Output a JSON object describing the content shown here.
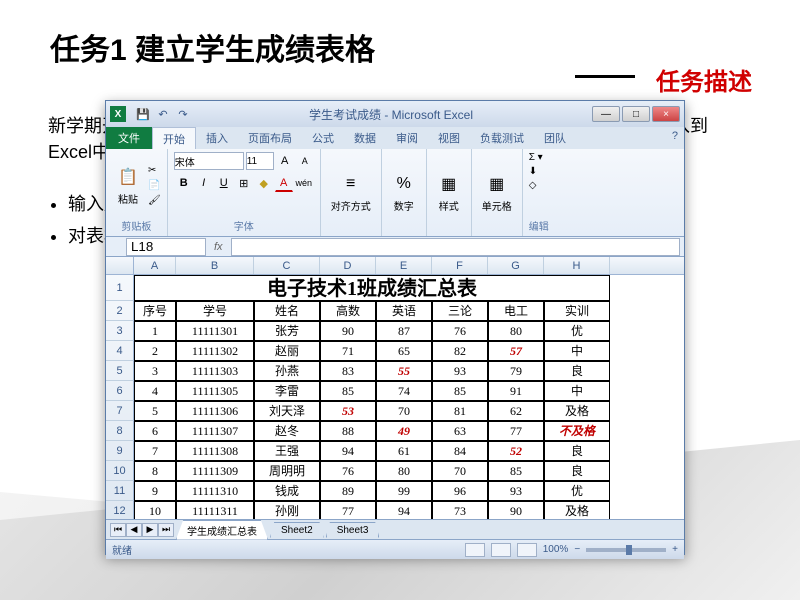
{
  "slide": {
    "title": "任务1  建立学生成绩表格",
    "subtitle": "任务描述",
    "desc1": "新学期开",
    "desc1_right": "勺成绩输入到",
    "desc2": "Excel中",
    "desc2_right": "：",
    "bullet1": "输入序",
    "bullet2": "对表格"
  },
  "window": {
    "app_icon": "X",
    "title": "学生考试成绩 - Microsoft Excel",
    "min": "—",
    "max": "□",
    "close": "×"
  },
  "tabs": {
    "file": "文件",
    "items": [
      "开始",
      "插入",
      "页面布局",
      "公式",
      "数据",
      "审阅",
      "视图",
      "负载测试",
      "团队"
    ],
    "help": "?"
  },
  "ribbon": {
    "clipboard": {
      "label": "剪贴板",
      "paste": "粘贴",
      "paste_icon": "📋"
    },
    "font": {
      "label": "字体",
      "name": "宋体",
      "size": "11",
      "bold": "B",
      "italic": "I",
      "underline": "U",
      "border": "⊞",
      "fill": "◆",
      "color": "A",
      "grow": "A",
      "shrink": "A",
      "wen": "wén"
    },
    "align": {
      "label": "对齐方式",
      "icon": "≡"
    },
    "number": {
      "label": "数字",
      "icon": "%"
    },
    "styles": {
      "label": "样式",
      "icon": "▦"
    },
    "cells": {
      "label": "单元格",
      "icon": "▦"
    },
    "editing": {
      "label": "编辑",
      "sigma": "Σ",
      "fill": "⬇",
      "clear": "◇"
    }
  },
  "namebox": {
    "cell": "L18",
    "fx": "fx"
  },
  "columns": [
    "A",
    "B",
    "C",
    "D",
    "E",
    "F",
    "G",
    "H"
  ],
  "table": {
    "title": "电子技术1班成绩汇总表",
    "headers": [
      "序号",
      "学号",
      "姓名",
      "高数",
      "英语",
      "三论",
      "电工",
      "实训"
    ],
    "rows": [
      {
        "n": "1",
        "id": "11111301",
        "name": "张芳",
        "c1": "90",
        "c2": "87",
        "c3": "76",
        "c4": "80",
        "c5": "优",
        "r2": false,
        "r4": false,
        "r5": false
      },
      {
        "n": "2",
        "id": "11111302",
        "name": "赵丽",
        "c1": "71",
        "c2": "65",
        "c3": "82",
        "c4": "57",
        "c5": "中",
        "r2": false,
        "r4": true,
        "r5": false
      },
      {
        "n": "3",
        "id": "11111303",
        "name": "孙燕",
        "c1": "83",
        "c2": "55",
        "c3": "93",
        "c4": "79",
        "c5": "良",
        "r2": true,
        "r4": false,
        "r5": false
      },
      {
        "n": "4",
        "id": "11111305",
        "name": "李雷",
        "c1": "85",
        "c2": "74",
        "c3": "85",
        "c4": "91",
        "c5": "中",
        "r2": false,
        "r4": false,
        "r5": false
      },
      {
        "n": "5",
        "id": "11111306",
        "name": "刘天泽",
        "c1": "53",
        "c2": "70",
        "c3": "81",
        "c4": "62",
        "c5": "及格",
        "r1": true,
        "r2": false,
        "r4": false,
        "r5": false
      },
      {
        "n": "6",
        "id": "11111307",
        "name": "赵冬",
        "c1": "88",
        "c2": "49",
        "c3": "63",
        "c4": "77",
        "c5": "不及格",
        "r2": true,
        "r4": false,
        "r5": true
      },
      {
        "n": "7",
        "id": "11111308",
        "name": "王强",
        "c1": "94",
        "c2": "61",
        "c3": "84",
        "c4": "52",
        "c5": "良",
        "r2": false,
        "r4": true,
        "r5": false
      },
      {
        "n": "8",
        "id": "11111309",
        "name": "周明明",
        "c1": "76",
        "c2": "80",
        "c3": "70",
        "c4": "85",
        "c5": "良",
        "r2": false,
        "r4": false,
        "r5": false
      },
      {
        "n": "9",
        "id": "11111310",
        "name": "钱成",
        "c1": "89",
        "c2": "99",
        "c3": "96",
        "c4": "93",
        "c5": "优",
        "r2": false,
        "r4": false,
        "r5": false
      },
      {
        "n": "10",
        "id": "11111311",
        "name": "孙刚",
        "c1": "77",
        "c2": "94",
        "c3": "73",
        "c4": "90",
        "c5": "及格",
        "r2": false,
        "r4": false,
        "r5": false
      }
    ]
  },
  "sheets": {
    "active": "学生成绩汇总表",
    "s2": "Sheet2",
    "s3": "Sheet3"
  },
  "status": {
    "ready": "就绪",
    "zoom": "100%",
    "minus": "−",
    "plus": "+"
  }
}
